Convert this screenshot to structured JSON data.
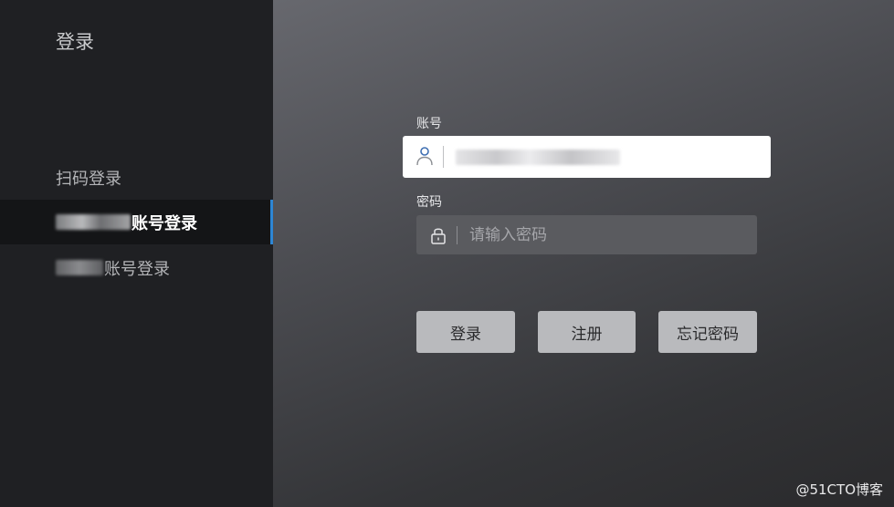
{
  "sidebar": {
    "title": "登录",
    "items": [
      {
        "label": "扫码登录"
      },
      {
        "label": "账号登录"
      },
      {
        "label": "账号登录"
      }
    ]
  },
  "form": {
    "account": {
      "label": "账号",
      "icon": "user-icon"
    },
    "password": {
      "label": "密码",
      "icon": "lock-icon",
      "placeholder": "请输入密码"
    },
    "buttons": {
      "login": "登录",
      "register": "注册",
      "forgot": "忘记密码"
    }
  },
  "watermark": "@51CTO博客",
  "colors": {
    "accent": "#2d86d4",
    "user_icon": "#3f6fb2"
  }
}
